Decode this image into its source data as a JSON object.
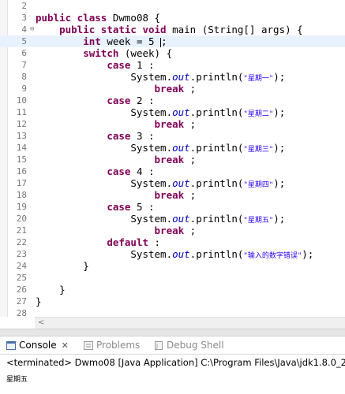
{
  "editor": {
    "lines": [
      {
        "n": "2",
        "fold": "",
        "parts": []
      },
      {
        "n": "3",
        "fold": "",
        "parts": [
          {
            "t": "kw",
            "v": "public class"
          },
          {
            "t": "p",
            "v": " Dwmo08 {"
          }
        ]
      },
      {
        "n": "4",
        "fold": "⊖",
        "parts": [
          {
            "t": "p",
            "v": "    "
          },
          {
            "t": "kw",
            "v": "public static void"
          },
          {
            "t": "p",
            "v": " main (String[] args) {"
          }
        ]
      },
      {
        "n": "5",
        "fold": "",
        "current": true,
        "parts": [
          {
            "t": "p",
            "v": "        "
          },
          {
            "t": "kw",
            "v": "int"
          },
          {
            "t": "p",
            "v": " week = 5 "
          },
          {
            "t": "cursor",
            "v": ""
          },
          {
            "t": "p",
            "v": ";"
          }
        ]
      },
      {
        "n": "6",
        "fold": "",
        "parts": [
          {
            "t": "p",
            "v": "        "
          },
          {
            "t": "kw",
            "v": "switch"
          },
          {
            "t": "p",
            "v": " (week) {"
          }
        ]
      },
      {
        "n": "7",
        "fold": "",
        "parts": [
          {
            "t": "p",
            "v": "            "
          },
          {
            "t": "kw",
            "v": "case"
          },
          {
            "t": "p",
            "v": " 1 :"
          }
        ]
      },
      {
        "n": "8",
        "fold": "",
        "parts": [
          {
            "t": "p",
            "v": "                System."
          },
          {
            "t": "fld",
            "v": "out"
          },
          {
            "t": "p",
            "v": ".println("
          },
          {
            "t": "str",
            "v": "\"星期一\""
          },
          {
            "t": "p",
            "v": ");"
          }
        ]
      },
      {
        "n": "9",
        "fold": "",
        "parts": [
          {
            "t": "p",
            "v": "                    "
          },
          {
            "t": "kw",
            "v": "break"
          },
          {
            "t": "p",
            "v": " ;"
          }
        ]
      },
      {
        "n": "10",
        "fold": "",
        "parts": [
          {
            "t": "p",
            "v": "            "
          },
          {
            "t": "kw",
            "v": "case"
          },
          {
            "t": "p",
            "v": " 2 :"
          }
        ]
      },
      {
        "n": "11",
        "fold": "",
        "parts": [
          {
            "t": "p",
            "v": "                System."
          },
          {
            "t": "fld",
            "v": "out"
          },
          {
            "t": "p",
            "v": ".println("
          },
          {
            "t": "str",
            "v": "\"星期二\""
          },
          {
            "t": "p",
            "v": ");"
          }
        ]
      },
      {
        "n": "12",
        "fold": "",
        "parts": [
          {
            "t": "p",
            "v": "                    "
          },
          {
            "t": "kw",
            "v": "break"
          },
          {
            "t": "p",
            "v": " ;"
          }
        ]
      },
      {
        "n": "13",
        "fold": "",
        "parts": [
          {
            "t": "p",
            "v": "            "
          },
          {
            "t": "kw",
            "v": "case"
          },
          {
            "t": "p",
            "v": " 3 :"
          }
        ]
      },
      {
        "n": "14",
        "fold": "",
        "parts": [
          {
            "t": "p",
            "v": "                System."
          },
          {
            "t": "fld",
            "v": "out"
          },
          {
            "t": "p",
            "v": ".println("
          },
          {
            "t": "str",
            "v": "\"星期三\""
          },
          {
            "t": "p",
            "v": ");"
          }
        ]
      },
      {
        "n": "15",
        "fold": "",
        "parts": [
          {
            "t": "p",
            "v": "                    "
          },
          {
            "t": "kw",
            "v": "break"
          },
          {
            "t": "p",
            "v": " ;"
          }
        ]
      },
      {
        "n": "16",
        "fold": "",
        "parts": [
          {
            "t": "p",
            "v": "            "
          },
          {
            "t": "kw",
            "v": "case"
          },
          {
            "t": "p",
            "v": " 4 :"
          }
        ]
      },
      {
        "n": "17",
        "fold": "",
        "parts": [
          {
            "t": "p",
            "v": "                System."
          },
          {
            "t": "fld",
            "v": "out"
          },
          {
            "t": "p",
            "v": ".println("
          },
          {
            "t": "str",
            "v": "\"星期四\""
          },
          {
            "t": "p",
            "v": ");"
          }
        ]
      },
      {
        "n": "18",
        "fold": "",
        "parts": [
          {
            "t": "p",
            "v": "                    "
          },
          {
            "t": "kw",
            "v": "break"
          },
          {
            "t": "p",
            "v": " ;"
          }
        ]
      },
      {
        "n": "19",
        "fold": "",
        "parts": [
          {
            "t": "p",
            "v": "            "
          },
          {
            "t": "kw",
            "v": "case"
          },
          {
            "t": "p",
            "v": " 5 :"
          }
        ]
      },
      {
        "n": "20",
        "fold": "",
        "parts": [
          {
            "t": "p",
            "v": "                System."
          },
          {
            "t": "fld",
            "v": "out"
          },
          {
            "t": "p",
            "v": ".println("
          },
          {
            "t": "str",
            "v": "\"星期五\""
          },
          {
            "t": "p",
            "v": ");"
          }
        ]
      },
      {
        "n": "21",
        "fold": "",
        "parts": [
          {
            "t": "p",
            "v": "                    "
          },
          {
            "t": "kw",
            "v": "break"
          },
          {
            "t": "p",
            "v": " ;"
          }
        ]
      },
      {
        "n": "22",
        "fold": "",
        "parts": [
          {
            "t": "p",
            "v": "            "
          },
          {
            "t": "kw",
            "v": "default"
          },
          {
            "t": "p",
            "v": " :"
          }
        ]
      },
      {
        "n": "23",
        "fold": "",
        "parts": [
          {
            "t": "p",
            "v": "                System."
          },
          {
            "t": "fld",
            "v": "out"
          },
          {
            "t": "p",
            "v": ".println("
          },
          {
            "t": "str",
            "v": "\"输入的数字错误\""
          },
          {
            "t": "p",
            "v": ");"
          }
        ]
      },
      {
        "n": "24",
        "fold": "",
        "parts": [
          {
            "t": "p",
            "v": "        }"
          }
        ]
      },
      {
        "n": "25",
        "fold": "",
        "parts": []
      },
      {
        "n": "26",
        "fold": "",
        "parts": [
          {
            "t": "p",
            "v": "    }"
          }
        ]
      },
      {
        "n": "27",
        "fold": "",
        "parts": [
          {
            "t": "p",
            "v": "}"
          }
        ]
      },
      {
        "n": "28",
        "fold": "",
        "parts": []
      }
    ]
  },
  "scroll": {
    "left_arrow": "<"
  },
  "tabs": {
    "console": {
      "label": "Console",
      "close": "✕",
      "icon": "console-icon"
    },
    "problems": {
      "label": "Problems",
      "icon": "problems-icon"
    },
    "debug_shell": {
      "label": "Debug Shell",
      "icon": "debug-shell-icon"
    }
  },
  "console": {
    "status": "<terminated> Dwmo08 [Java Application] C:\\Program Files\\Java\\jdk1.8.0_2",
    "output": "星期五"
  },
  "colors": {
    "keyword": "#7f0055",
    "string": "#2a00ff",
    "field": "#0000c0",
    "current_line": "#e8f2fe"
  }
}
